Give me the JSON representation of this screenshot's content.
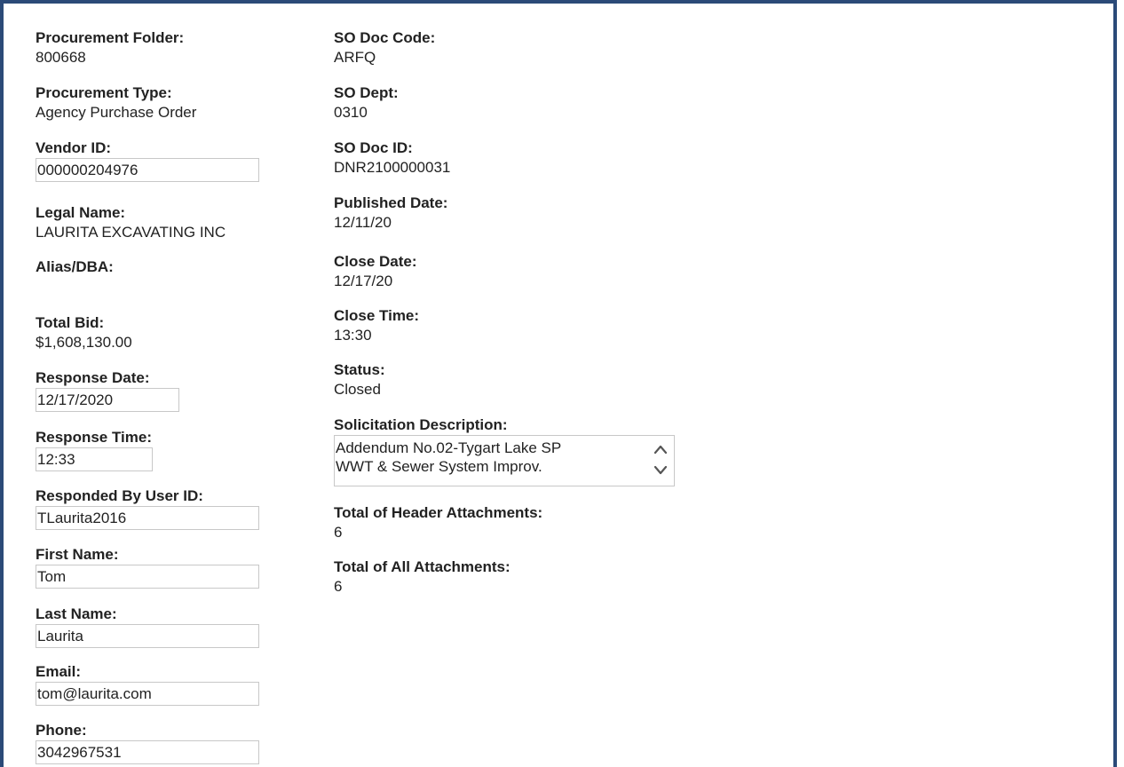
{
  "left": {
    "procurement_folder": {
      "label": "Procurement Folder:",
      "value": "800668"
    },
    "procurement_type": {
      "label": "Procurement Type:",
      "value": "Agency Purchase Order"
    },
    "vendor_id": {
      "label": "Vendor ID:",
      "value": "000000204976"
    },
    "legal_name": {
      "label": "Legal Name:",
      "value": "LAURITA EXCAVATING INC"
    },
    "alias_dba": {
      "label": "Alias/DBA:",
      "value": ""
    },
    "total_bid": {
      "label": "Total Bid:",
      "value": "$1,608,130.00"
    },
    "response_date": {
      "label": "Response Date:",
      "value": "12/17/2020"
    },
    "response_time": {
      "label": "Response Time:",
      "value": "12:33"
    },
    "responded_by": {
      "label": "Responded By User ID:",
      "value": "TLaurita2016"
    },
    "first_name": {
      "label": "First Name:",
      "value": "Tom"
    },
    "last_name": {
      "label": "Last Name:",
      "value": "Laurita"
    },
    "email": {
      "label": "Email:",
      "value": "tom@laurita.com"
    },
    "phone": {
      "label": "Phone:",
      "value": "3042967531"
    }
  },
  "right": {
    "so_doc_code": {
      "label": "SO Doc Code:",
      "value": "ARFQ"
    },
    "so_dept": {
      "label": "SO Dept:",
      "value": "0310"
    },
    "so_doc_id": {
      "label": "SO Doc ID:",
      "value": "DNR2100000031"
    },
    "published_date": {
      "label": "Published Date:",
      "value": "12/11/20"
    },
    "close_date": {
      "label": "Close Date:",
      "value": "12/17/20"
    },
    "close_time": {
      "label": "Close Time:",
      "value": "13:30"
    },
    "status": {
      "label": "Status:",
      "value": "Closed"
    },
    "solicitation_description": {
      "label": "Solicitation Description:",
      "line1": "Addendum No.02-Tygart Lake SP",
      "line2": "WWT & Sewer System Improv."
    },
    "total_header_attachments": {
      "label": "Total of Header Attachments:",
      "value": "6"
    },
    "total_all_attachments": {
      "label": "Total of All Attachments:",
      "value": "6"
    }
  },
  "icons": {
    "scroll_up": "chevron-up-icon",
    "scroll_down": "chevron-down-icon"
  },
  "colors": {
    "frame_border": "#2b4a78",
    "input_border": "#c8c8c8",
    "text": "#222222"
  }
}
